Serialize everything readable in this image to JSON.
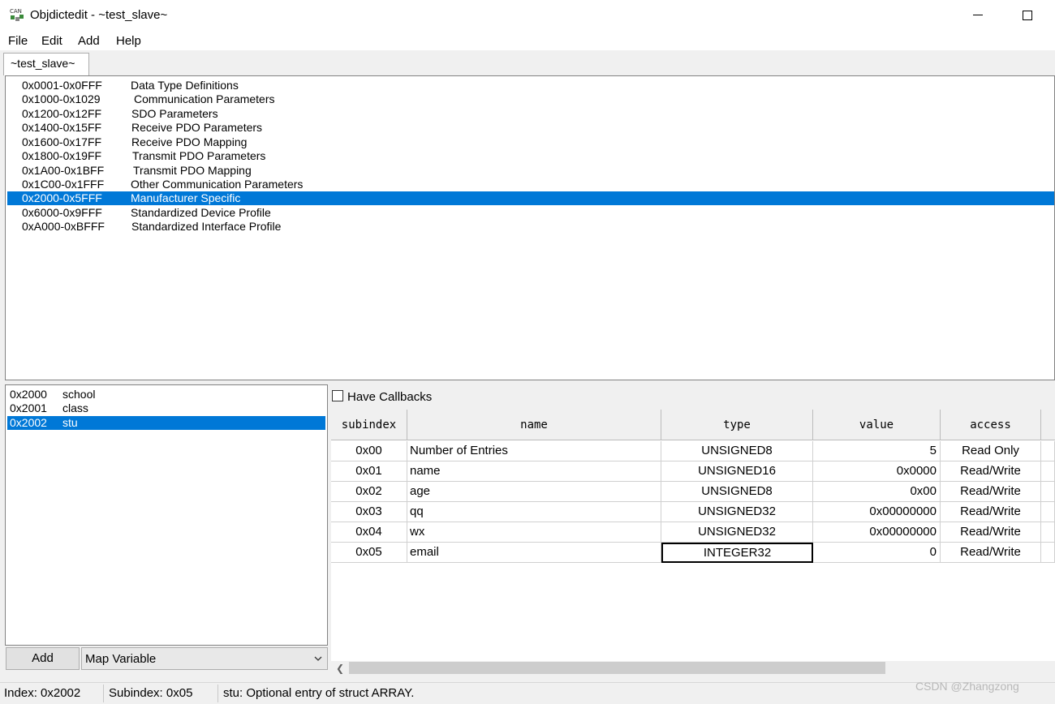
{
  "window": {
    "title": "Objdictedit - ~test_slave~",
    "icon": "can-app-icon"
  },
  "menu": [
    "File",
    "Edit",
    "Add",
    "Help"
  ],
  "tab": {
    "label": "~test_slave~"
  },
  "categories": [
    {
      "range": "0x0001-0x0FFF",
      "name": "Data Type Definitions"
    },
    {
      "range": "0x1000-0x1029",
      "name": "Communication Parameters"
    },
    {
      "range": "0x1200-0x12FF",
      "name": "SDO Parameters"
    },
    {
      "range": "0x1400-0x15FF",
      "name": "Receive PDO Parameters"
    },
    {
      "range": "0x1600-0x17FF",
      "name": "Receive PDO Mapping"
    },
    {
      "range": "0x1800-0x19FF",
      "name": "Transmit PDO Parameters"
    },
    {
      "range": "0x1A00-0x1BFF",
      "name": "Transmit PDO Mapping"
    },
    {
      "range": "0x1C00-0x1FFF",
      "name": "Other Communication Parameters"
    },
    {
      "range": "0x2000-0x5FFF",
      "name": "Manufacturer Specific",
      "selected": true
    },
    {
      "range": "0x6000-0x9FFF",
      "name": "Standardized Device Profile"
    },
    {
      "range": "0xA000-0xBFFF",
      "name": "Standardized Interface Profile"
    }
  ],
  "indexes": [
    {
      "code": "0x2000",
      "name": "school"
    },
    {
      "code": "0x2001",
      "name": "class"
    },
    {
      "code": "0x2002",
      "name": "stu",
      "selected": true
    }
  ],
  "controls": {
    "add_label": "Add",
    "map_variable": "Map Variable"
  },
  "callbacks": {
    "label": "Have Callbacks",
    "checked": false
  },
  "grid": {
    "headers": {
      "subindex": "subindex",
      "name": "name",
      "type": "type",
      "value": "value",
      "access": "access"
    },
    "rows": [
      {
        "subindex": "0x00",
        "name": "Number of Entries",
        "type": "UNSIGNED8",
        "value": "5",
        "access": "Read Only"
      },
      {
        "subindex": "0x01",
        "name": "name",
        "type": "UNSIGNED16",
        "value": "0x0000",
        "access": "Read/Write"
      },
      {
        "subindex": "0x02",
        "name": "age",
        "type": "UNSIGNED8",
        "value": "0x00",
        "access": "Read/Write"
      },
      {
        "subindex": "0x03",
        "name": "qq",
        "type": "UNSIGNED32",
        "value": "0x00000000",
        "access": "Read/Write"
      },
      {
        "subindex": "0x04",
        "name": "wx",
        "type": "UNSIGNED32",
        "value": "0x00000000",
        "access": "Read/Write"
      },
      {
        "subindex": "0x05",
        "name": "email",
        "type": "INTEGER32",
        "value": "0",
        "access": "Read/Write",
        "focused": true
      }
    ]
  },
  "status": {
    "index": "Index: 0x2002",
    "subindex": "Subindex: 0x05",
    "message": "stu: Optional entry of struct ARRAY."
  },
  "watermark": "CSDN @Zhangzong",
  "colors": {
    "selection": "#0078d7"
  }
}
